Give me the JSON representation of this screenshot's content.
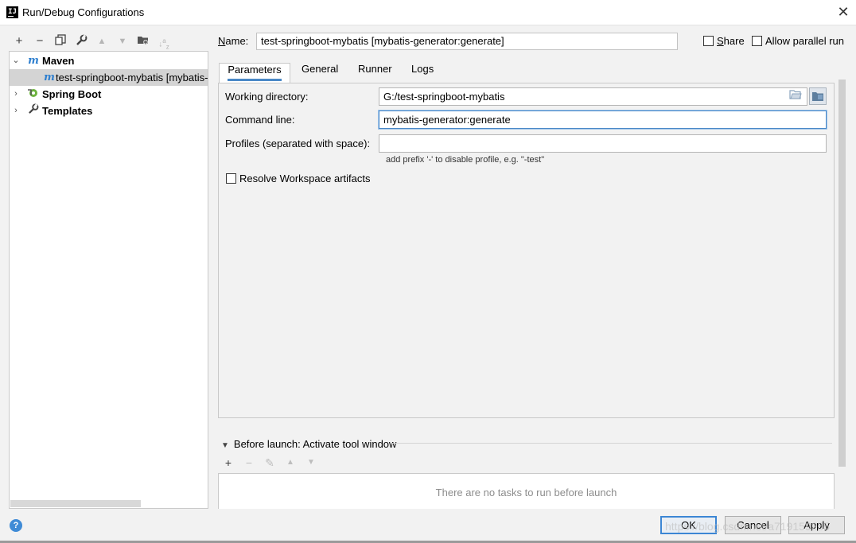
{
  "window": {
    "title": "Run/Debug Configurations",
    "icon_text": "IJ"
  },
  "toolbar": {
    "icons": [
      "add-icon",
      "remove-icon",
      "copy-icon",
      "wrench-icon",
      "move-up-icon",
      "move-down-icon",
      "new-folder-icon",
      "sort-icon"
    ],
    "sort_glyph": "↓a​z"
  },
  "tree": {
    "items": [
      {
        "label": "Maven",
        "icon": "maven-icon",
        "expanded": true,
        "bold": true
      },
      {
        "label": "test-springboot-mybatis [mybatis-generator:generate]",
        "icon": "maven-config-icon",
        "selected": true
      },
      {
        "label": "Spring Boot",
        "icon": "spring-boot-icon",
        "expanded": false,
        "bold": true
      },
      {
        "label": "Templates",
        "icon": "wrench-icon",
        "expanded": false,
        "bold": true
      }
    ]
  },
  "name": {
    "label_prefix": "N",
    "label_rest": "ame:",
    "value": "test-springboot-mybatis [mybatis-generator:generate]"
  },
  "share": {
    "label_prefix": "S",
    "label_rest": "hare",
    "checked": false
  },
  "parallel": {
    "label": "Allow parallel run",
    "checked": false
  },
  "tabs": [
    "Parameters",
    "General",
    "Runner",
    "Logs"
  ],
  "params": {
    "working_dir": {
      "label": "Working directory:",
      "value": "G:/test-springboot-mybatis"
    },
    "command_line": {
      "label": "Command line:",
      "value": "mybatis-generator:generate"
    },
    "profiles": {
      "label": "Profiles (separated with space):",
      "value": "",
      "hint": "add prefix '-' to disable profile, e.g. \"-test\""
    },
    "resolve": {
      "label": "Resolve Workspace artifacts",
      "checked": false
    }
  },
  "before_launch": {
    "title": "Before launch: Activate tool window",
    "empty_text": "There are no tasks to run before launch"
  },
  "buttons": {
    "ok": "OK",
    "cancel": "Cancel",
    "apply": "Apply"
  },
  "help_label": "?",
  "watermark": "https://blog.csdn.net/a719159255",
  "colors": {
    "accent": "#4a88c7",
    "selection": "#d4d4d4",
    "background": "#f2f2f2"
  }
}
